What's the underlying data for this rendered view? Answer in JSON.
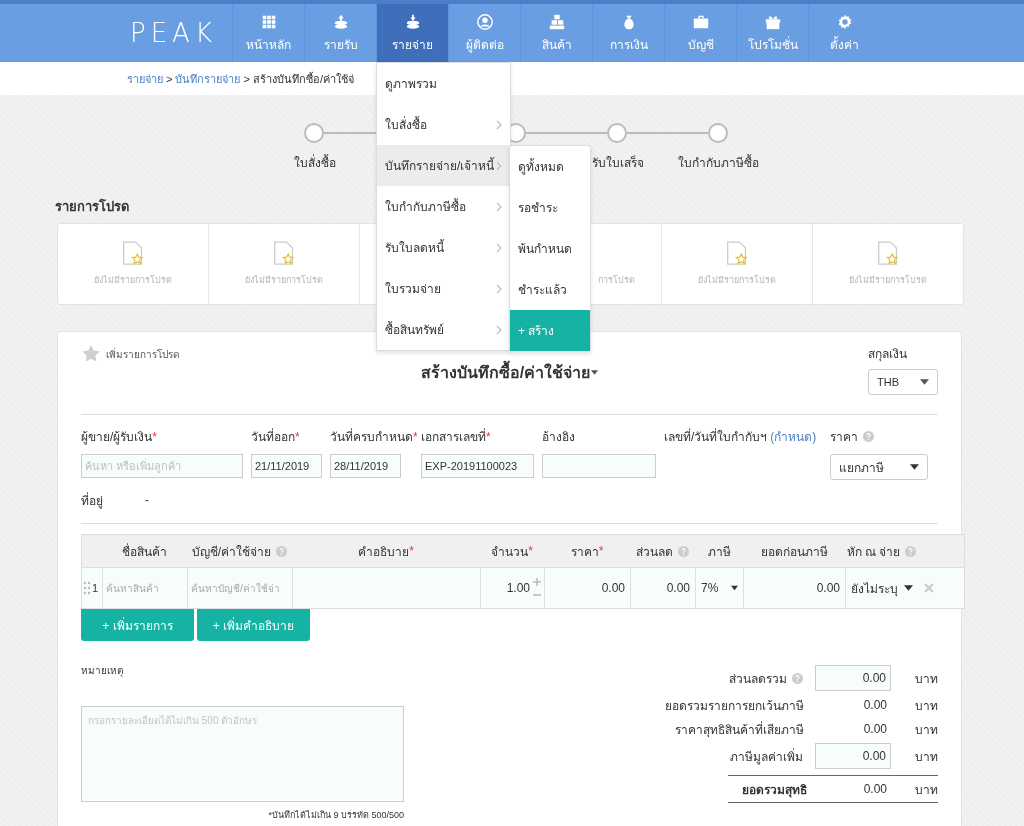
{
  "nav": {
    "logo": "PEAK",
    "items": [
      {
        "label": "หน้าหลัก",
        "selected": false
      },
      {
        "label": "รายรับ",
        "selected": false
      },
      {
        "label": "รายจ่าย",
        "selected": true
      },
      {
        "label": "ผู้ติดต่อ",
        "selected": false
      },
      {
        "label": "สินค้า",
        "selected": false
      },
      {
        "label": "การเงิน",
        "selected": false
      },
      {
        "label": "บัญชี",
        "selected": false
      },
      {
        "label": "โปรโมชั่น",
        "selected": false
      },
      {
        "label": "ตั้งค่า",
        "selected": false
      }
    ]
  },
  "breadcrumb": {
    "separator": ">",
    "items": [
      {
        "label": "รายจ่าย",
        "link": true
      },
      {
        "label": "บันทึกรายจ่าย",
        "link": true
      },
      {
        "label": "สร้างบันทึกซื้อ/ค่าใช้จ่",
        "link": false
      }
    ]
  },
  "steps": [
    {
      "kind": "labeled",
      "label": "ใบสั่งซื้อ"
    },
    {
      "kind": "hidden"
    },
    {
      "kind": "bare"
    },
    {
      "kind": "labeled",
      "label": "รับใบเสร็จ"
    },
    {
      "kind": "labeled",
      "label": "ใบกำกับภาษีซื้อ"
    }
  ],
  "favorites": {
    "title": "รายการโปรด",
    "cards": [
      {
        "kind": "text",
        "text": "ยังไม่มีรายการโปรด"
      },
      {
        "kind": "text",
        "text": "ยังไม่มีรายการโปรด"
      },
      {
        "kind": "blank"
      },
      {
        "kind": "partial",
        "text": "การโปรด"
      },
      {
        "kind": "text",
        "text": "ยังไม่มีรายการโปรด"
      },
      {
        "kind": "text",
        "text": "ยังไม่มีรายการโปรด"
      }
    ]
  },
  "menu": {
    "items": [
      {
        "label": "ดูภาพรวม",
        "has_submenu": false,
        "selected": false
      },
      {
        "label": "ใบสั่งซื้อ",
        "has_submenu": true,
        "selected": false
      },
      {
        "label": "บันทึกรายจ่าย/เจ้าหนี้",
        "has_submenu": true,
        "selected": true
      },
      {
        "label": "ใบกำกับภาษีซื้อ",
        "has_submenu": true,
        "selected": false
      },
      {
        "label": "รับใบลดหนี้",
        "has_submenu": true,
        "selected": false
      },
      {
        "label": "ใบรวมจ่าย",
        "has_submenu": true,
        "selected": false
      },
      {
        "label": "ซื้อสินทรัพย์",
        "has_submenu": true,
        "selected": false
      }
    ],
    "submenu": [
      {
        "label": "ดูทั้งหมด",
        "selected": false
      },
      {
        "label": "รอชำระ",
        "selected": false
      },
      {
        "label": "พ้นกำหนด",
        "selected": false
      },
      {
        "label": "ชำระแล้ว",
        "selected": false
      },
      {
        "label": "+ สร้าง",
        "selected": true
      }
    ]
  },
  "form": {
    "favorite": {
      "label": "เพิ่มรายการโปรด",
      "on": false
    },
    "title": "สร้างบันทึกซื้อ/ค่าใช้จ่าย",
    "currency": {
      "label": "สกุลเงิน",
      "value": "THB"
    },
    "fields": [
      {
        "kind": "input",
        "label": "ผู้ขาย/ผู้รับเงิน",
        "required_mark": "*",
        "help": false,
        "placeholder": "ค้นหา หรือเพิ่มลูกค้า"
      },
      {
        "kind": "input",
        "label": "วันที่ออก",
        "required_mark": "*",
        "help": false,
        "value": "21/11/2019"
      },
      {
        "kind": "input",
        "label": "วันที่ครบกำหนด",
        "required_mark": "*",
        "help": false,
        "value": "28/11/2019"
      },
      {
        "kind": "input",
        "label": "เอกสารเลขที่",
        "required_mark": "*",
        "help": false,
        "value": "EXP-20191100023"
      },
      {
        "kind": "input",
        "label": "อ้างอิง",
        "help": false
      },
      {
        "kind": "link",
        "label": "เลขที่/วันที่ใบกำกับฯ",
        "help": false,
        "link": "(กำหนด)"
      },
      {
        "kind": "select",
        "label": "ราคา",
        "help": true,
        "value": "แยกภาษี"
      }
    ],
    "address": {
      "label": "ที่อยู่",
      "value": "-"
    },
    "table": {
      "columns": [
        {
          "label": "ชื่อสินค้า",
          "help": false
        },
        {
          "label": "บัญชี/ค่าใช้จ่าย",
          "help": true
        },
        {
          "label": "คำอธิบาย",
          "required_mark": "*",
          "help": false
        },
        {
          "label": "จำนวน",
          "required_mark": "*",
          "help": false
        },
        {
          "label": "ราคา",
          "required_mark": "*",
          "help": false
        },
        {
          "label": "ส่วนลด",
          "help": true
        },
        {
          "label": "ภาษี",
          "help": false
        },
        {
          "label": "ยอดก่อนภาษี",
          "help": false
        },
        {
          "label": "หัก ณ จ่าย",
          "help": true
        }
      ],
      "rows": [
        {
          "index": "1",
          "product_placeholder": "ค้นหาสินค้า",
          "account_placeholder": "ค้นหาบัญชี/ค่าใช้จ่า",
          "quantity": "1.00",
          "price": "0.00",
          "discount": "0.00",
          "tax": "7%",
          "pretax": "0.00",
          "withholding": "ยังไม่ระบุ"
        }
      ]
    },
    "buttons": [
      "+ เพิ่มรายการ",
      "+ เพิ่มคำอธิบาย"
    ],
    "notes": {
      "label": "หมายเหตุ",
      "placeholder": "กรอกรายละเอียดได้ไม่เกิน 500 ตัวอักษร",
      "hint": "*บันทึกได้ไม่เกิน 9 บรรทัด 500/500"
    },
    "summary": [
      {
        "kind": "input",
        "label": "ส่วนลดรวม",
        "help": true,
        "value": "0.00",
        "unit": "บาท"
      },
      {
        "kind": "text",
        "label": "ยอดรวมรายการยกเว้นภาษี",
        "help": false,
        "value": "0.00",
        "unit": "บาท"
      },
      {
        "kind": "text",
        "label": "ราคาสุทธิสินค้าที่เสียภาษี",
        "help": false,
        "value": "0.00",
        "unit": "บาท"
      },
      {
        "kind": "input",
        "label": "ภาษีมูลค่าเพิ่ม",
        "help": false,
        "value": "0.00",
        "unit": "บาท"
      },
      {
        "kind": "total",
        "label": "ยอดรวมสุทธิ",
        "help": false,
        "value": "0.00",
        "unit": "บาท"
      }
    ]
  }
}
